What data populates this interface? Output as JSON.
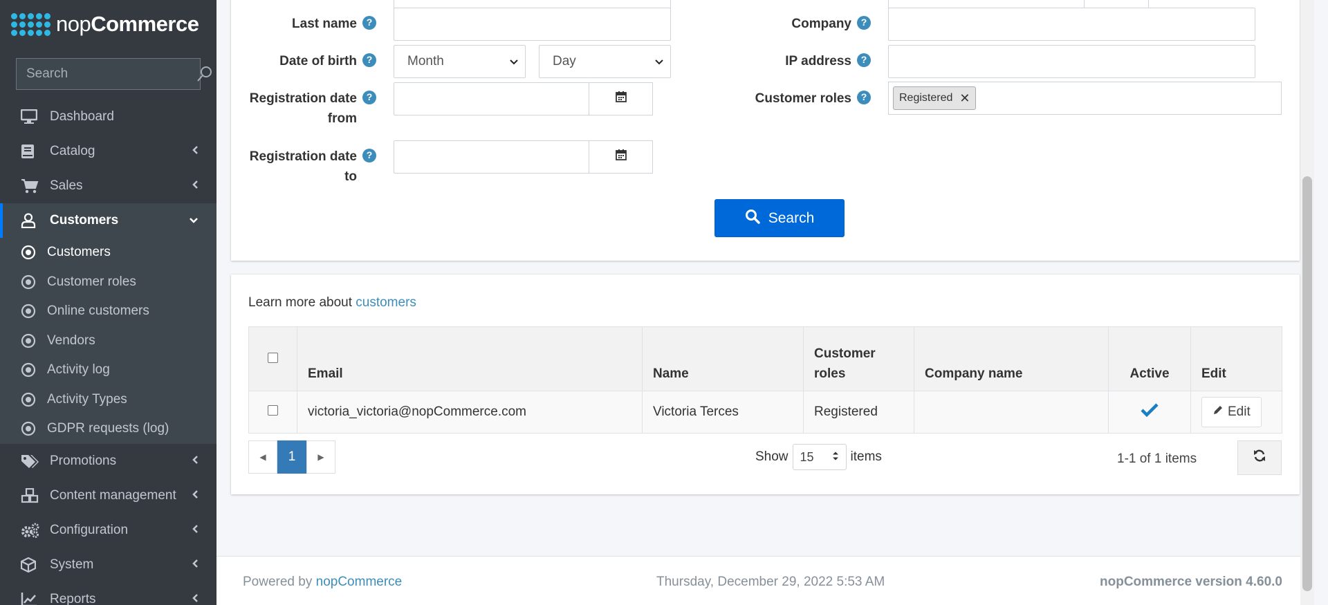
{
  "brand": {
    "name_light": "nop",
    "name_bold": "Commerce"
  },
  "sidebar": {
    "search_placeholder": "Search",
    "items": [
      {
        "label": "Dashboard",
        "icon": "monitor-icon"
      },
      {
        "label": "Catalog",
        "icon": "book-icon"
      },
      {
        "label": "Sales",
        "icon": "cart-icon"
      },
      {
        "label": "Customers",
        "icon": "user-icon"
      }
    ],
    "sub_items": [
      {
        "label": "Customers"
      },
      {
        "label": "Customer roles"
      },
      {
        "label": "Online customers"
      },
      {
        "label": "Vendors"
      },
      {
        "label": "Activity log"
      },
      {
        "label": "Activity Types"
      },
      {
        "label": "GDPR requests (log)"
      }
    ],
    "items_after": [
      {
        "label": "Promotions",
        "icon": "tags-icon"
      },
      {
        "label": "Content management",
        "icon": "cubes-icon"
      },
      {
        "label": "Configuration",
        "icon": "gears-icon"
      },
      {
        "label": "System",
        "icon": "cube-icon"
      },
      {
        "label": "Reports",
        "icon": "chart-line-icon"
      }
    ]
  },
  "search_form": {
    "last_name_label": "Last name",
    "dob_label": "Date of birth",
    "month_option": "Month",
    "day_option": "Day",
    "reg_from_label_1": "Registration date",
    "reg_from_label_2": "from",
    "reg_to_label_1": "Registration date",
    "reg_to_label_2": "to",
    "company_label": "Company",
    "ip_label": "IP address",
    "roles_label": "Customer roles",
    "selected_role": "Registered",
    "search_button": "Search"
  },
  "grid": {
    "learn_text": "Learn more about ",
    "learn_link": "customers",
    "columns": [
      "Email",
      "Name",
      "Customer roles",
      "Company name",
      "Active",
      "Edit"
    ],
    "rows": [
      {
        "email": "victoria_victoria@nopCommerce.com",
        "name": "Victoria Terces",
        "roles": "Registered",
        "company": "",
        "active": true,
        "edit_label": "Edit"
      }
    ],
    "pager": {
      "current_page": "1"
    },
    "show_label": "Show",
    "page_size": "15",
    "items_label": "items",
    "info": "1-1 of 1 items"
  },
  "footer": {
    "powered_by": "Powered by ",
    "powered_link": "nopCommerce",
    "datetime": "Thursday, December 29, 2022 5:53 AM",
    "version": "nopCommerce version 4.60.0"
  },
  "colors": {
    "sidebar_bg": "#343a40",
    "accent_blue": "#007bff",
    "button_blue": "#0069d9",
    "help_blue": "#3c8dbc",
    "pager_active": "#337ab7"
  }
}
